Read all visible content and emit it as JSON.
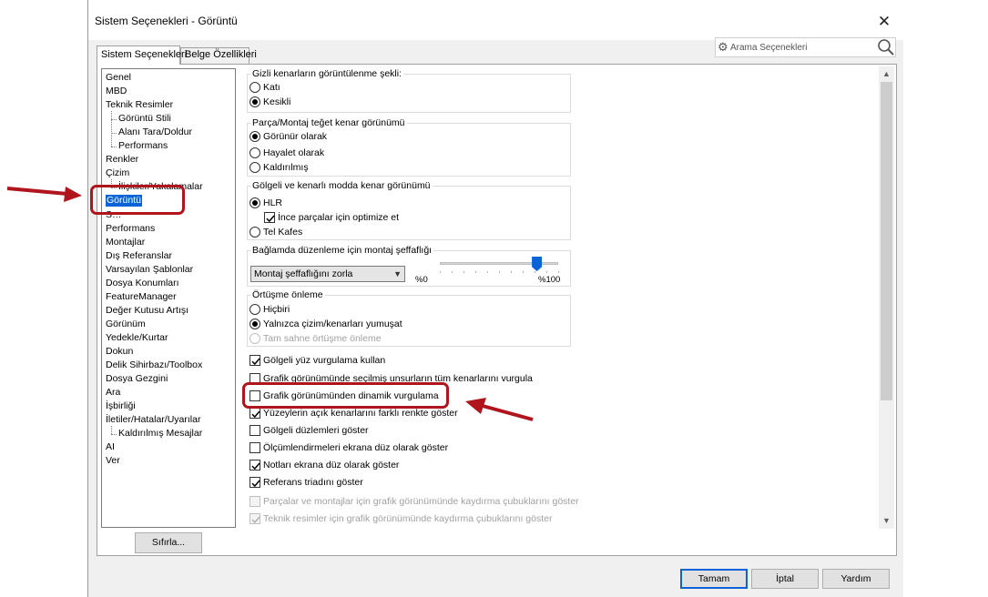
{
  "window": {
    "title": "Sistem Seçenekleri - Görüntü",
    "close_glyph": "✕"
  },
  "tabs": [
    {
      "label": "Sistem Seçenekleri",
      "active": true
    },
    {
      "label": "Belge Özellikleri",
      "active": false
    }
  ],
  "search": {
    "placeholder": "Arama Seçenekleri",
    "icon_left": "gear-icon",
    "icon_right": "search-icon"
  },
  "nav": {
    "items": [
      {
        "label": "Genel",
        "level": 0
      },
      {
        "label": "MBD",
        "level": 0
      },
      {
        "label": "Teknik Resimler",
        "level": 0
      },
      {
        "label": "Görüntü Stili",
        "level": 1
      },
      {
        "label": "Alanı Tara/Doldur",
        "level": 1
      },
      {
        "label": "Performans",
        "level": 1
      },
      {
        "label": "Renkler",
        "level": 0
      },
      {
        "label": "Çizim",
        "level": 0
      },
      {
        "label": "İlişkiler/Yakalamalar",
        "level": 1
      },
      {
        "label": "Görüntü",
        "level": 0,
        "selected": true
      },
      {
        "label": "S…",
        "level": 0
      },
      {
        "label": "Performans",
        "level": 0
      },
      {
        "label": "Montajlar",
        "level": 0
      },
      {
        "label": "Dış Referanslar",
        "level": 0
      },
      {
        "label": "Varsayılan Şablonlar",
        "level": 0
      },
      {
        "label": "Dosya Konumları",
        "level": 0
      },
      {
        "label": "FeatureManager",
        "level": 0
      },
      {
        "label": "Değer Kutusu Artışı",
        "level": 0
      },
      {
        "label": "Görünüm",
        "level": 0
      },
      {
        "label": "Yedekle/Kurtar",
        "level": 0
      },
      {
        "label": "Dokun",
        "level": 0
      },
      {
        "label": "Delik Sihirbazı/Toolbox",
        "level": 0
      },
      {
        "label": "Dosya Gezgini",
        "level": 0
      },
      {
        "label": "Ara",
        "level": 0
      },
      {
        "label": "İşbirliği",
        "level": 0
      },
      {
        "label": "İletiler/Hatalar/Uyarılar",
        "level": 0
      },
      {
        "label": "Kaldırılmış Mesajlar",
        "level": 1
      },
      {
        "label": "AI",
        "level": 0
      },
      {
        "label": "Ver",
        "level": 0
      }
    ],
    "reset_label": "Sıfırla..."
  },
  "groups": {
    "hidden_edges": {
      "label": "Gizli kenarların görüntülenme şekli:",
      "options": [
        {
          "label": "Katı",
          "selected": false
        },
        {
          "label": "Kesikli",
          "selected": true
        }
      ]
    },
    "tangent_edges": {
      "label": "Parça/Montaj teğet kenar görünümü",
      "options": [
        {
          "label": "Görünür olarak",
          "selected": true
        },
        {
          "label": "Hayalet olarak",
          "selected": false
        },
        {
          "label": "Kaldırılmış",
          "selected": false
        }
      ]
    },
    "shaded_edges": {
      "label": "Gölgeli ve kenarlı modda kenar görünümü",
      "hlr_label": "HLR",
      "hlr_selected": true,
      "optimize_label": "İnce parçalar için optimize et",
      "optimize_checked": true,
      "wireframe_label": "Tel Kafes",
      "wireframe_selected": false
    },
    "transparency": {
      "label": "Bağlamda düzenleme için montaj şeffaflığı",
      "combo_value": "Montaj şeffaflığını zorla",
      "min_label": "%0",
      "max_label": "%100",
      "slider_value_fraction": 0.82
    },
    "antialiasing": {
      "label": "Örtüşme önleme",
      "options": [
        {
          "label": "Hiçbiri",
          "selected": false,
          "disabled": false
        },
        {
          "label": "Yalnızca çizim/kenarları yumuşat",
          "selected": true,
          "disabled": false
        },
        {
          "label": "Tam sahne örtüşme önleme",
          "selected": false,
          "disabled": true
        }
      ]
    }
  },
  "checkboxes": [
    {
      "label": "Gölgeli yüz vurgulama kullan",
      "checked": true,
      "disabled": false
    },
    {
      "label": "Grafik görünümünde seçilmiş unsurların tüm kenarlarını vurgula",
      "checked": false,
      "disabled": false
    },
    {
      "label": "Grafik görünümünden dinamik vurgulama",
      "checked": false,
      "disabled": false
    },
    {
      "label": "Yüzeylerin açık kenarlarını farklı renkte göster",
      "checked": true,
      "disabled": false
    },
    {
      "label": "Gölgeli düzlemleri göster",
      "checked": false,
      "disabled": false
    },
    {
      "label": "Ölçümlendirmeleri ekrana düz olarak göster",
      "checked": false,
      "disabled": false
    },
    {
      "label": "Notları ekrana düz olarak göster",
      "checked": true,
      "disabled": false
    },
    {
      "label": "Referans triadını göster",
      "checked": true,
      "disabled": false
    },
    {
      "label": "Parçalar ve montajlar için grafik görünümünde kaydırma çubuklarını göster",
      "checked": false,
      "disabled": true
    },
    {
      "label": "Teknik resimler için grafik görünümünde kaydırma çubuklarını göster",
      "checked": true,
      "disabled": true
    }
  ],
  "buttons": {
    "ok": "Tamam",
    "cancel": "İptal",
    "help": "Yardım"
  },
  "annotation": {
    "color": "#b0151e"
  },
  "colors": {
    "selection": "#0a64d8",
    "dialog_bg": "#f0f0f0"
  }
}
